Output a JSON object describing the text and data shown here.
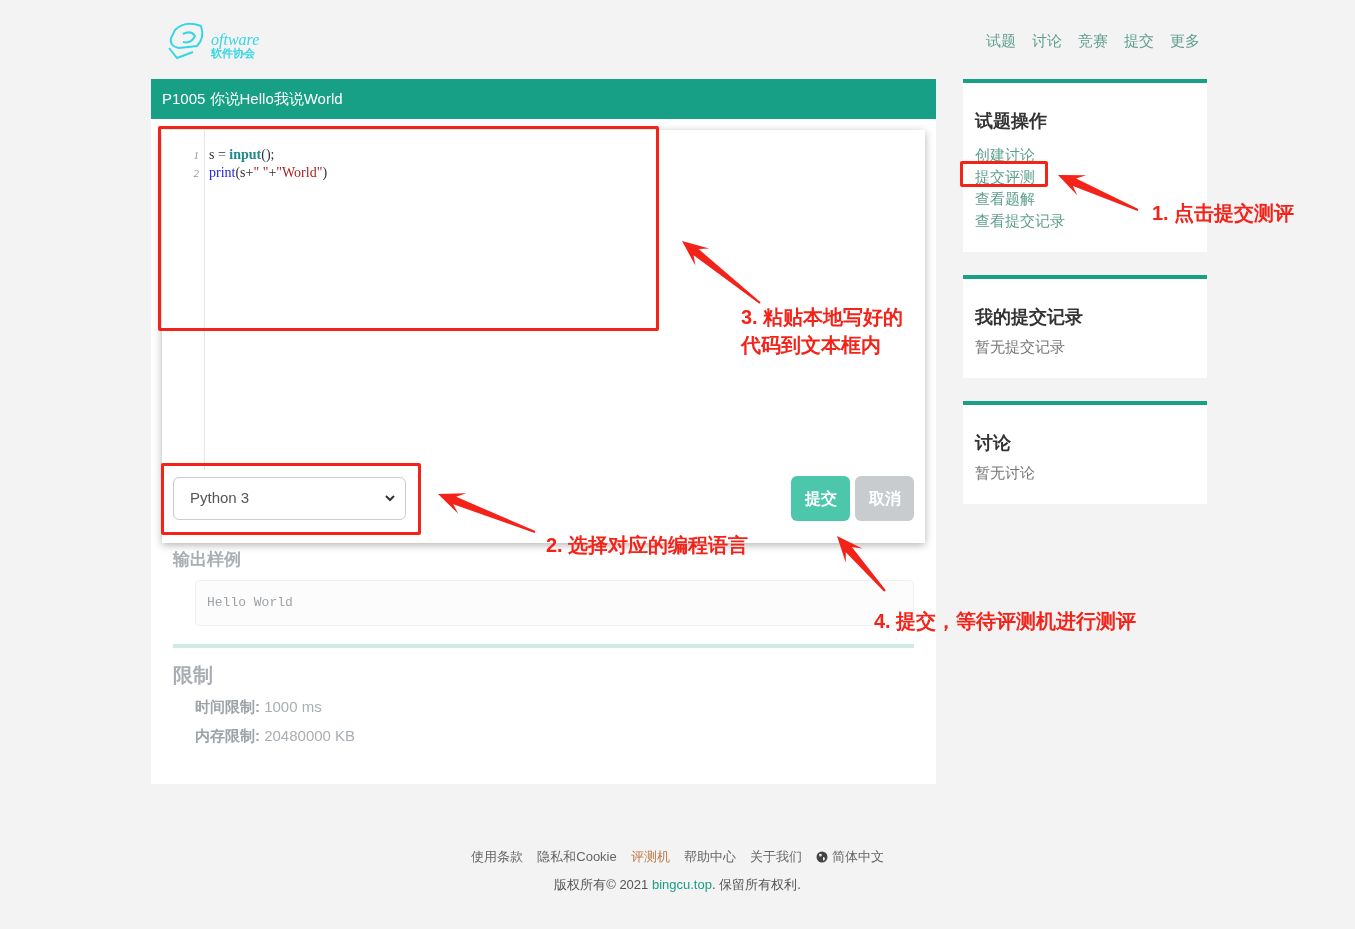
{
  "logo": {
    "script": "oftware",
    "subtitle": "软件协会"
  },
  "nav": [
    "试题",
    "讨论",
    "竞赛",
    "提交",
    "更多"
  ],
  "problem": {
    "title": "P1005 你说Hello我说World",
    "sections": [
      {
        "blocks": [
          {
            "kind": "subheading",
            "text": "输出样例"
          },
          {
            "kind": "code",
            "text": "Hello World"
          }
        ]
      },
      {
        "heading": "限制",
        "blocks": [
          {
            "kind": "limit",
            "label": "时间限制:",
            "value": "1000 ms"
          },
          {
            "kind": "limit",
            "label": "内存限制:",
            "value": "20480000 KB"
          }
        ]
      }
    ]
  },
  "submit_dialog": {
    "code_lines": [
      {
        "number": "1",
        "tokens": [
          {
            "kind": "plain",
            "text": "s = "
          },
          {
            "kind": "builtin",
            "text": "input"
          },
          {
            "kind": "plain",
            "text": "();"
          }
        ]
      },
      {
        "number": "2",
        "tokens": [
          {
            "kind": "keyword",
            "text": "print"
          },
          {
            "kind": "plain",
            "text": "(s+"
          },
          {
            "kind": "string",
            "text": "\" \""
          },
          {
            "kind": "plain",
            "text": "+"
          },
          {
            "kind": "string",
            "text": "\"World\""
          },
          {
            "kind": "plain",
            "text": ")"
          }
        ]
      }
    ],
    "language": "Python 3",
    "buttons": [
      {
        "label": "提交",
        "kind": "primary"
      },
      {
        "label": "取消",
        "kind": "secondary"
      }
    ]
  },
  "sidebar": [
    {
      "title": "试题操作",
      "links": [
        "创建讨论",
        "提交评测",
        "查看题解",
        "查看提交记录"
      ]
    },
    {
      "title": "我的提交记录",
      "empty": "暂无提交记录"
    },
    {
      "title": "讨论",
      "empty": "暂无讨论"
    }
  ],
  "annotations": [
    "1. 点击提交测评",
    "2. 选择对应的编程语言",
    "3. 粘贴本地写好的代码到文本框内",
    "4. 提交，等待评测机进行测评"
  ],
  "footer": {
    "links": [
      {
        "label": "使用条款",
        "selected": false
      },
      {
        "label": "隐私和Cookie",
        "selected": false
      },
      {
        "label": "评测机",
        "selected": true
      },
      {
        "label": "帮助中心",
        "selected": false
      },
      {
        "label": "关于我们",
        "selected": false
      }
    ],
    "language": "简体中文",
    "copyright_before": "版权所有© 2021 ",
    "copyright_link": "bingcu.top",
    "copyright_after": ". 保留所有权利."
  }
}
